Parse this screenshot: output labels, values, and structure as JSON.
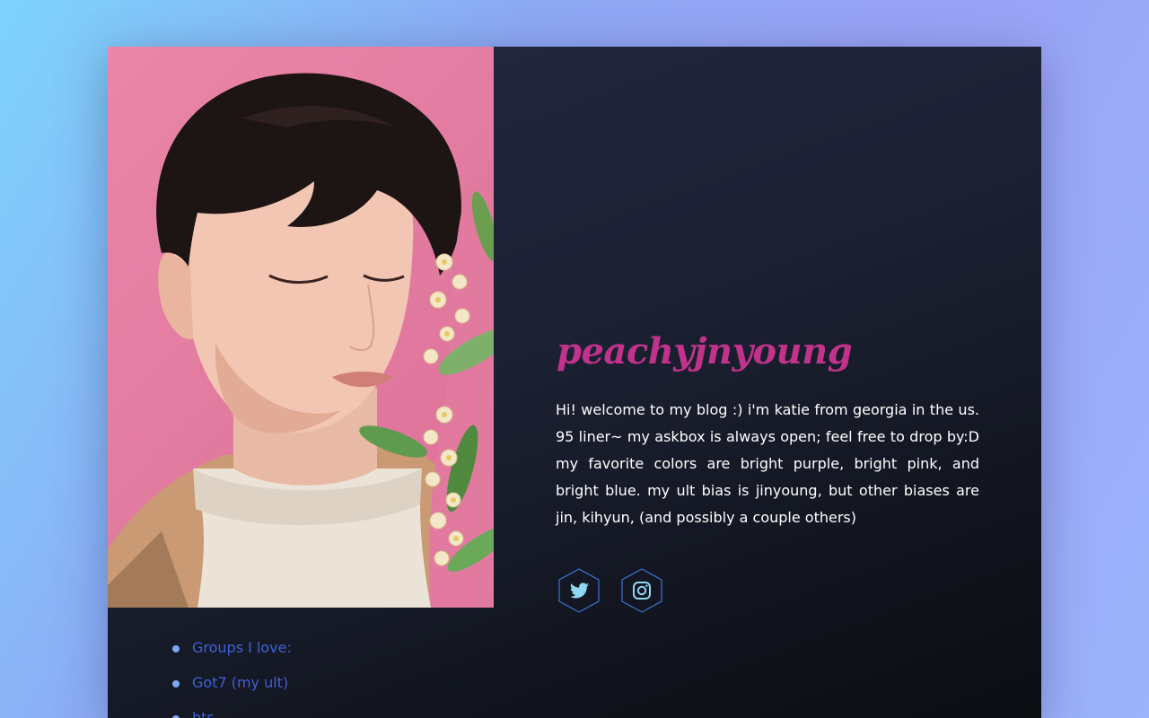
{
  "blog": {
    "title": "peachyjnyoung",
    "bio": "Hi! welcome to my blog :) i'm katie from georgia in the us. 95 liner~ my askbox is always open; feel free to drop by:D my favorite colors are bright purple, bright pink, and bright blue. my ult bias is jinyoung, but other biases are jin, kihyun, (and possibly a couple others)"
  },
  "social": [
    {
      "icon": "twitter-icon"
    },
    {
      "icon": "instagram-icon"
    }
  ],
  "groups": {
    "items": [
      "Groups I love:",
      "Got7 (my ult)",
      "bts"
    ]
  },
  "colors": {
    "title": "#c1338a",
    "list_text": "#3f60d6",
    "bullet": "#7ea5f2",
    "icon_outline": "#3d74d6",
    "icon_fill": "#8fd8f5"
  }
}
